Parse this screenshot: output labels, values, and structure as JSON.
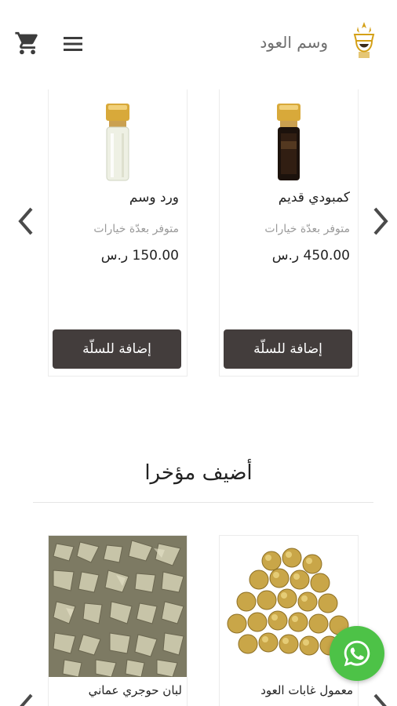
{
  "header": {
    "brand_name": "وسم العود",
    "cart_icon": "cart-icon",
    "menu_icon": "hamburger-menu-icon",
    "logo_icon": "crown-logo-icon"
  },
  "featured": {
    "products": [
      {
        "title": "كمبودي قديم",
        "availability": "متوفر بعدّة خيارات",
        "price": "450.00 ر.س",
        "button_label": "إضافة للسلّة",
        "image": "dark-oil-bottle"
      },
      {
        "title": "ورد وسم",
        "availability": "متوفر بعدّة خيارات",
        "price": "150.00 ر.س",
        "button_label": "إضافة للسلّة",
        "image": "clear-oil-bottle"
      }
    ]
  },
  "recent": {
    "section_title": "أضيف مؤخرا",
    "products": [
      {
        "title": "معمول غابات العود",
        "image": "gold-wrapped-bakhoor"
      },
      {
        "title": "لبان حوجري عماني",
        "image": "frankincense-resin"
      }
    ]
  },
  "colors": {
    "button_bg": "#433d3c",
    "whatsapp": "#4dc247",
    "gold": "#d4a017"
  }
}
